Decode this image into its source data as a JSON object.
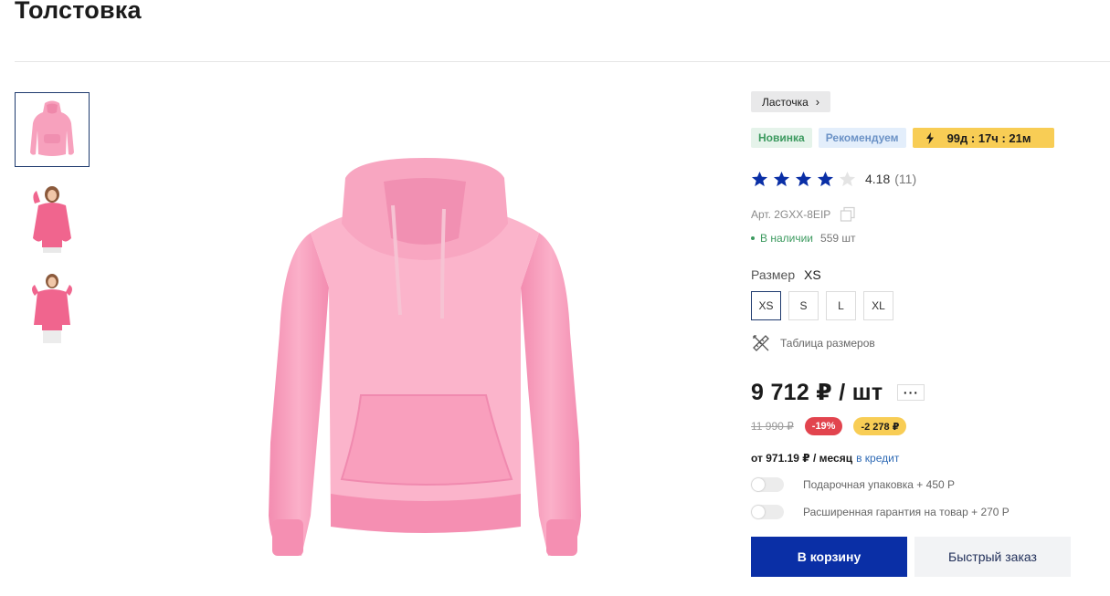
{
  "product": {
    "title": "Толстовка",
    "article": "Арт. 2GXX-8EIP",
    "brand": "Ласточка"
  },
  "badges": {
    "new": "Новинка",
    "recommended": "Рекомендуем",
    "timer": "99д : 17ч : 21м"
  },
  "rating": {
    "value": "4.18",
    "count": "(11)",
    "stars_filled": 4,
    "stars_total": 5
  },
  "stock": {
    "status": "В наличии",
    "quantity": "559 шт"
  },
  "size": {
    "label": "Размер",
    "selected": "XS",
    "options": [
      "XS",
      "S",
      "L",
      "XL"
    ],
    "table_label": "Таблица размеров"
  },
  "price": {
    "current": "9 712 ₽ / шт",
    "old": "11 990 ₽",
    "discount": "-19%",
    "saving": "-2 278 ₽",
    "more": "···"
  },
  "credit": {
    "text": "от 971.19 ₽ / месяц",
    "link": "в кредит"
  },
  "options": [
    {
      "label": "Подарочная упаковка + 450 Р"
    },
    {
      "label": "Расширенная гарантия на товар + 270 Р"
    }
  ],
  "actions": {
    "cart": "В корзину",
    "quick": "Быстрый заказ"
  },
  "colors": {
    "primary": "#0a2fa6",
    "accent_yellow": "#f8cd55",
    "discount_red": "#e2444e",
    "success_green": "#3c9a5f",
    "hoodie_pink": "#f9a3bf"
  },
  "icons": {
    "brand_chevron": "chevron-right-icon",
    "timer": "lightning-icon",
    "copy": "copy-icon",
    "size_table": "ruler-pencil-icon"
  }
}
